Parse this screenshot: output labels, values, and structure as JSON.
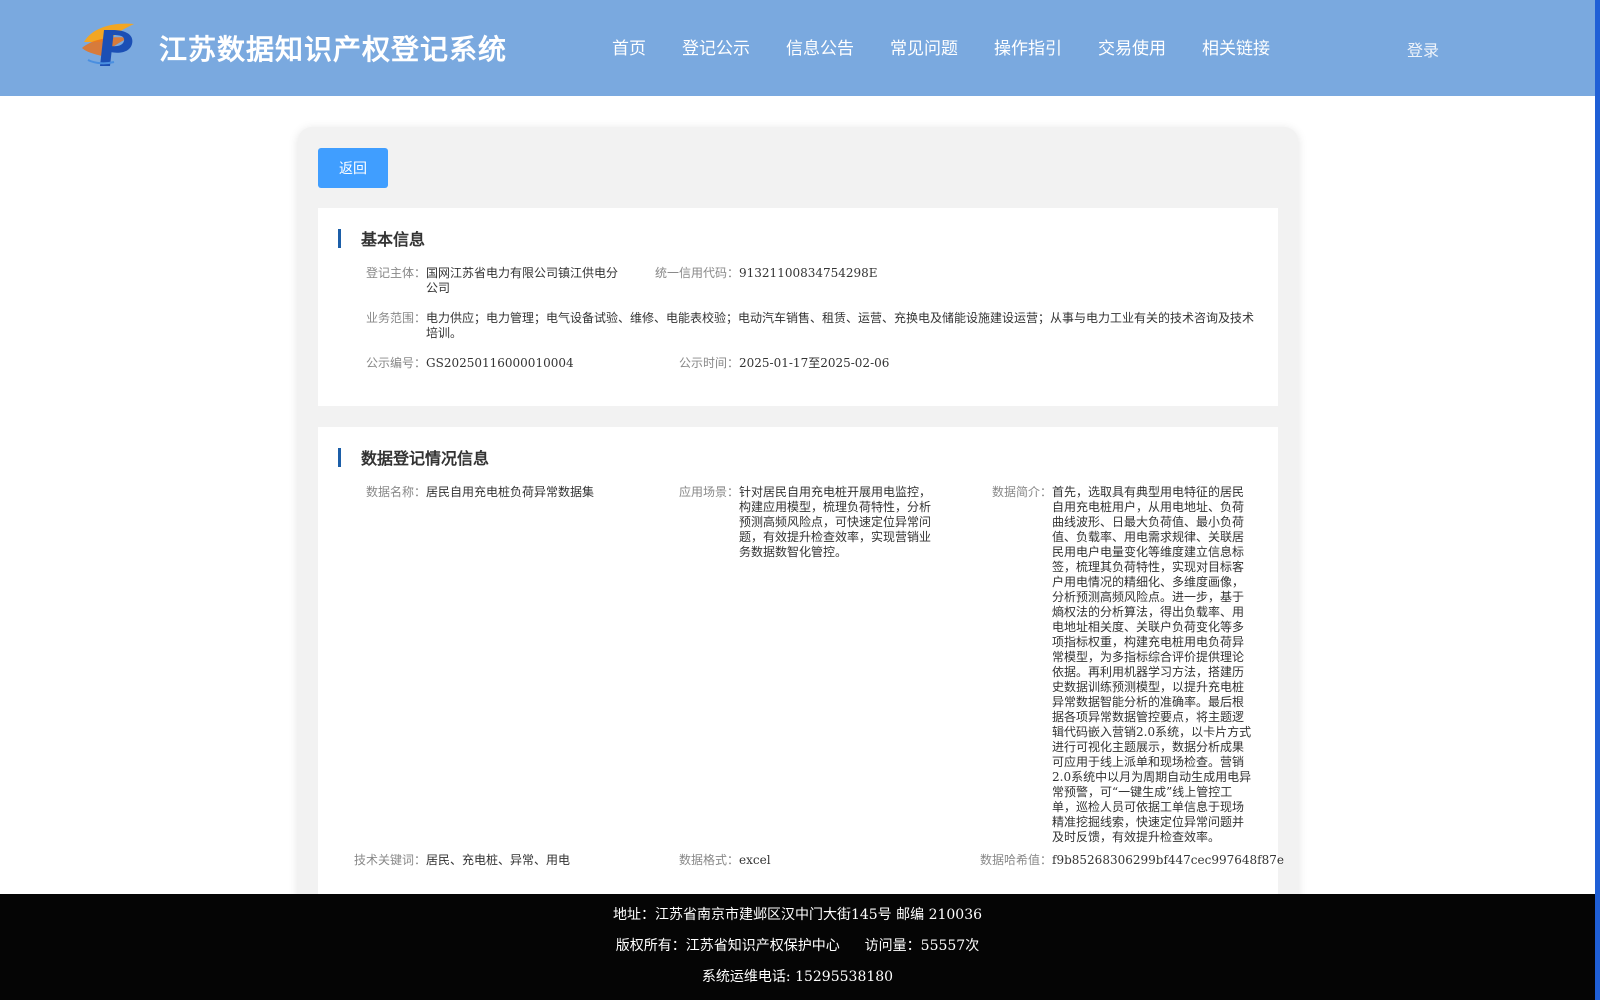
{
  "header": {
    "title": "江苏数据知识产权登记系统",
    "nav": [
      "首页",
      "登记公示",
      "信息公告",
      "常见问题",
      "操作指引",
      "交易使用",
      "相关链接"
    ],
    "login": "登录"
  },
  "back_label": "返回",
  "basic": {
    "title": "基本信息",
    "subject_label": "登记主体：",
    "subject": "国网江苏省电力有限公司镇江供电分公司",
    "credit_label": "统一信用代码：",
    "credit": "91321100834754298E",
    "scope_label": "业务范围：",
    "scope": "电力供应；电力管理；电气设备试验、维修、电能表校验；电动汽车销售、租赁、运营、充换电及储能设施建设运营；从事与电力工业有关的技术咨询及技术培训。",
    "pub_no_label": "公示编号：",
    "pub_no": "GS20250116000010004",
    "pub_time_label": "公示时间：",
    "pub_time": "2025-01-17至2025-02-06"
  },
  "data_info": {
    "title": "数据登记情况信息",
    "name_label": "数据名称：",
    "name": "居民自用充电桩负荷异常数据集",
    "scene_label": "应用场景：",
    "scene": "针对居民自用充电桩开展用电监控，构建应用模型，梳理负荷特性，分析预测高频风险点，可快速定位异常问题，有效提升检查效率，实现营销业务数据数智化管控。",
    "intro_label": "数据简介：",
    "intro": "首先，选取具有典型用电特征的居民自用充电桩用户，从用电地址、负荷曲线波形、日最大负荷值、最小负荷值、负载率、用电需求规律、关联居民用电户电量变化等维度建立信息标签，梳理其负荷特性，实现对目标客户用电情况的精细化、多维度画像，分析预测高频风险点。进一步，基于熵权法的分析算法，得出负载率、用电地址相关度、关联户负荷变化等多项指标权重，构建充电桩用电负荷异常模型，为多指标综合评价提供理论依据。再利用机器学习方法，搭建历史数据训练预测模型，以提升充电桩异常数据智能分析的准确率。最后根据各项异常数据管控要点，将主题逻辑代码嵌入营销2.0系统，以卡片方式进行可视化主题展示，数据分析成果可应用于线上派单和现场检查。营销2.0系统中以月为周期自动生成用电异常预警，可“一键生成”线上管控工单，巡检人员可依据工单信息于现场精准挖掘线索，快速定位异常问题并及时反馈，有效提升检查效率。",
    "keywords_label": "技术关键词：",
    "keywords": "居民、充电桩、异常、用电",
    "format_label": "数据格式：",
    "format": "excel",
    "hash_label": "数据哈希值：",
    "hash": "f9b85268306299bf447cec997648f87e"
  },
  "footer": {
    "address": "地址：江苏省南京市建邺区汉中门大街145号 邮编 210036",
    "copyright": "版权所有：江苏省知识产权保护中心",
    "visits": "访问量：55557次",
    "phone": "系统运维电话: 15295538180"
  },
  "colors": {
    "header_bg": "#7aa9df",
    "button": "#409eff",
    "section_bar": "#1c5ea8",
    "footer_bg": "#050505"
  }
}
